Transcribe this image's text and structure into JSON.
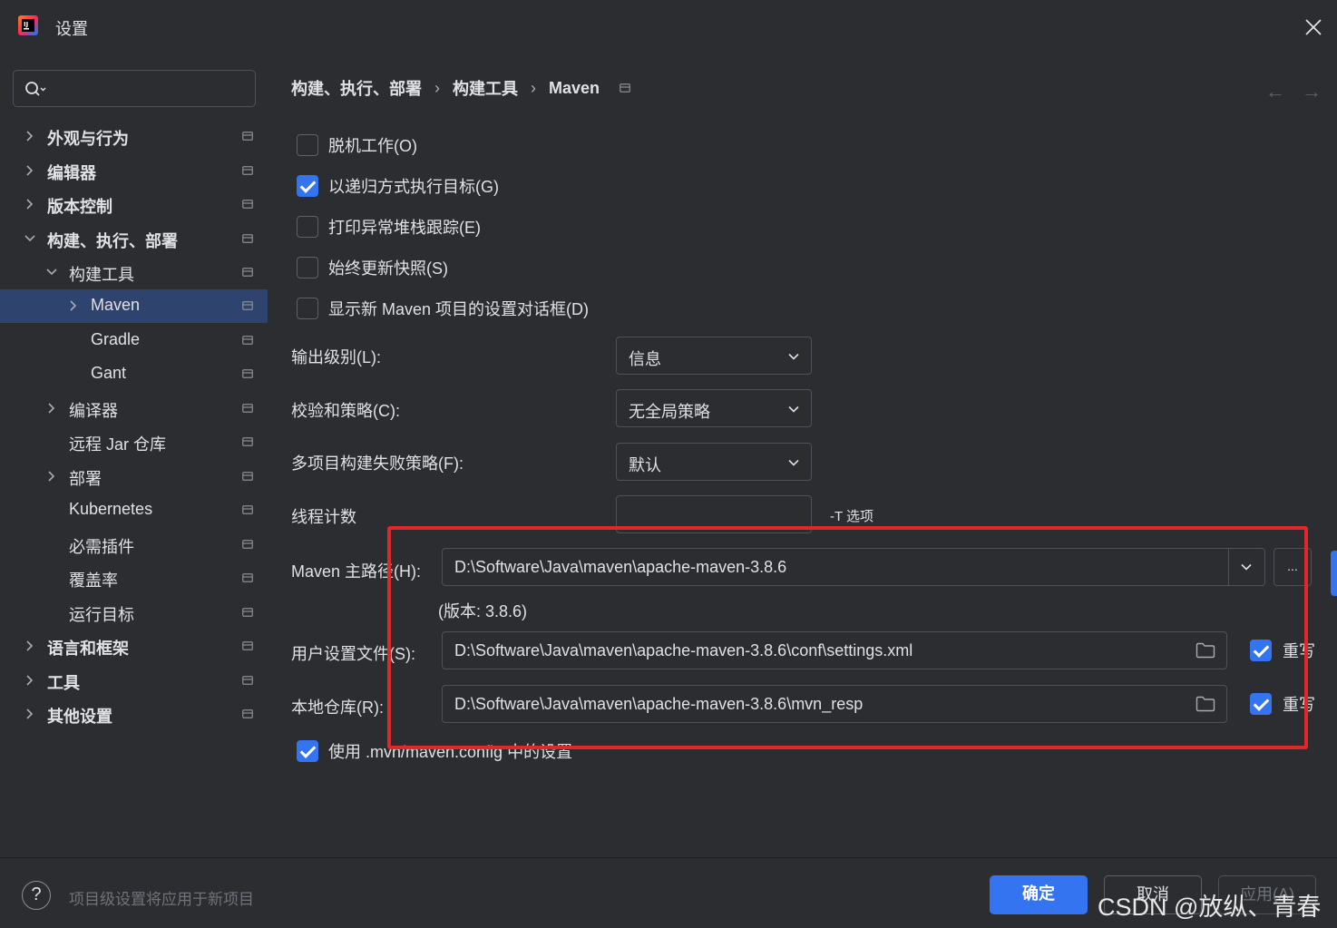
{
  "window": {
    "title": "设置"
  },
  "search": {
    "placeholder": ""
  },
  "sidebar": {
    "items": [
      {
        "label": "外观与行为"
      },
      {
        "label": "编辑器"
      },
      {
        "label": "版本控制"
      },
      {
        "label": "构建、执行、部署"
      },
      {
        "label": "构建工具"
      },
      {
        "label": "Maven"
      },
      {
        "label": "Gradle"
      },
      {
        "label": "Gant"
      },
      {
        "label": "编译器"
      },
      {
        "label": "远程 Jar 仓库"
      },
      {
        "label": "部署"
      },
      {
        "label": "Kubernetes"
      },
      {
        "label": "必需插件"
      },
      {
        "label": "覆盖率"
      },
      {
        "label": "运行目标"
      },
      {
        "label": "语言和框架"
      },
      {
        "label": "工具"
      },
      {
        "label": "其他设置"
      }
    ]
  },
  "breadcrumb": {
    "items": [
      "构建、执行、部署",
      "构建工具",
      "Maven"
    ],
    "separator": "›"
  },
  "nav": {
    "back": "←",
    "forward": "→"
  },
  "checkboxes": [
    {
      "label": "脱机工作(O)",
      "checked": false
    },
    {
      "label": "以递归方式执行目标(G)",
      "checked": true
    },
    {
      "label": "打印异常堆栈跟踪(E)",
      "checked": false
    },
    {
      "label": "始终更新快照(S)",
      "checked": false
    },
    {
      "label": "显示新 Maven 项目的设置对话框(D)",
      "checked": false
    }
  ],
  "fields": {
    "output_level": {
      "label": "输出级别(L):",
      "value": "信息"
    },
    "checksum_policy": {
      "label": "校验和策略(C):",
      "value": "无全局策略"
    },
    "multiproject_fail": {
      "label": "多项目构建失败策略(F):",
      "value": "默认"
    },
    "thread_count": {
      "label": "线程计数",
      "value": "",
      "hint": "-T 选项"
    },
    "maven_home": {
      "label": "Maven 主路径(H):",
      "value": "D:\\Software\\Java\\maven\\apache-maven-3.8.6",
      "browse": "...",
      "version": "(版本: 3.8.6)"
    },
    "user_settings": {
      "label": "用户设置文件(S):",
      "value": "D:\\Software\\Java\\maven\\apache-maven-3.8.6\\conf\\settings.xml",
      "override_label": "重写",
      "override": true
    },
    "local_repo": {
      "label": "本地仓库(R):",
      "value": "D:\\Software\\Java\\maven\\apache-maven-3.8.6\\mvn_resp",
      "override_label": "重写",
      "override": true
    },
    "use_mvn_config": {
      "label": "使用 .mvn/maven.config 中的设置",
      "checked": true
    }
  },
  "footer": {
    "help": "?",
    "hint": "项目级设置将应用于新项目",
    "ok": "确定",
    "cancel": "取消",
    "apply": "应用(A)"
  },
  "watermark": "CSDN @放纵、青春",
  "colors": {
    "accent": "#3574f0",
    "background": "#2b2d30",
    "selection": "#2e436e",
    "highlight_box": "#e0272b"
  }
}
